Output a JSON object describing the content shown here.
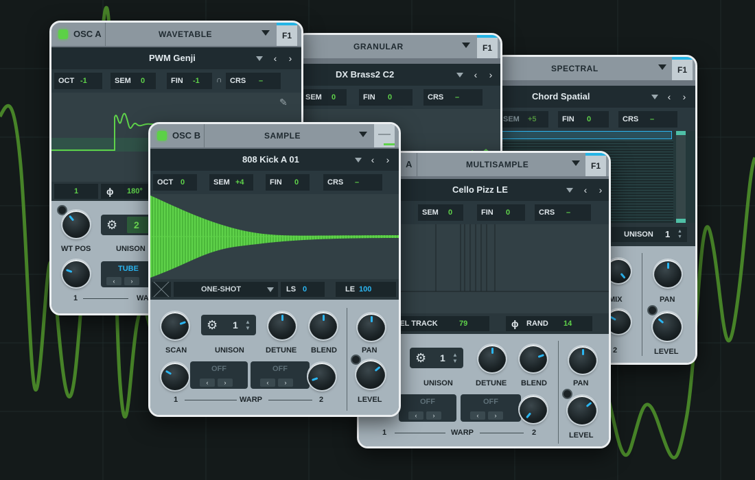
{
  "colors": {
    "accent_green": "#5fd24a",
    "accent_blue": "#2bb6f2",
    "panel_border": "#eceff1"
  },
  "panels": {
    "osc_a": {
      "name": "OSC A",
      "type": "WAVETABLE",
      "filter": "F1",
      "preset": "PWM Genji",
      "tune": {
        "oct_label": "OCT",
        "oct": "-1",
        "sem_label": "SEM",
        "sem": "0",
        "fin_label": "FIN",
        "fin": "-1",
        "crs_label": "CRS",
        "crs": "–"
      },
      "footer": {
        "left": "1",
        "phase": "180°"
      },
      "controls": {
        "wt_pos": "WT POS",
        "unison_label": "UNISON",
        "unison": "2",
        "warp_mode": "TUBE",
        "warp_num": "1",
        "warp_label": "WA"
      }
    },
    "granular": {
      "type": "GRANULAR",
      "filter": "F1",
      "preset": "DX Brass2 C2",
      "tune": {
        "sem_label": "SEM",
        "sem": "0",
        "fin_label": "FIN",
        "fin": "0",
        "crs_label": "CRS",
        "crs": "–"
      }
    },
    "spectral": {
      "type": "SPECTRAL",
      "filter": "F1",
      "preset": "Chord Spatial",
      "tune": {
        "sem_label": "SEM",
        "sem": "+5",
        "fin_label": "FIN",
        "fin": "0",
        "crs_label": "CRS",
        "crs": "–"
      },
      "unison_label": "UNISON",
      "unison": "1",
      "mix_label": "MIX",
      "controls": {
        "pan": "PAN",
        "level": "LEVEL",
        "knob_num": "2"
      }
    },
    "multisample": {
      "osc_letter": "A",
      "type": "MULTISAMPLE",
      "filter": "F1",
      "preset": "Cello Pizz LE",
      "tune": {
        "sem_label": "SEM",
        "sem": "0",
        "fin_label": "FIN",
        "fin": "0",
        "crs_label": "CRS",
        "crs": "–"
      },
      "footer": {
        "level_track_label": "VEL TRACK",
        "level_track": "79",
        "rand_label": "RAND",
        "rand": "14"
      },
      "controls": {
        "unison_label": "UNISON",
        "unison": "1",
        "detune": "DETUNE",
        "blend": "BLEND",
        "pan": "PAN",
        "level": "LEVEL",
        "warp_off1": "OFF",
        "warp_off2": "OFF",
        "warp_label": "WARP",
        "warp_left": "1",
        "warp_right": "2"
      }
    },
    "osc_b": {
      "name": "OSC B",
      "type": "SAMPLE",
      "preset": "808 Kick A 01",
      "tune": {
        "oct_label": "OCT",
        "oct": "0",
        "sem_label": "SEM",
        "sem": "+4",
        "fin_label": "FIN",
        "fin": "0",
        "crs_label": "CRS",
        "crs": "–"
      },
      "footer": {
        "mode": "ONE-SHOT",
        "ls_label": "LS",
        "ls": "0",
        "le_label": "LE",
        "le": "100"
      },
      "controls": {
        "scan": "SCAN",
        "unison_label": "UNISON",
        "unison": "1",
        "detune": "DETUNE",
        "blend": "BLEND",
        "pan": "PAN",
        "level": "LEVEL",
        "warp_off1": "OFF",
        "warp_off2": "OFF",
        "warp_label": "WARP",
        "warp_left": "1",
        "warp_right": "2"
      }
    }
  },
  "icons": {
    "gear": "⚙",
    "phase": "ϕ",
    "prev": "‹",
    "next": "›",
    "spin_up": "▲",
    "spin_down": "▼"
  }
}
